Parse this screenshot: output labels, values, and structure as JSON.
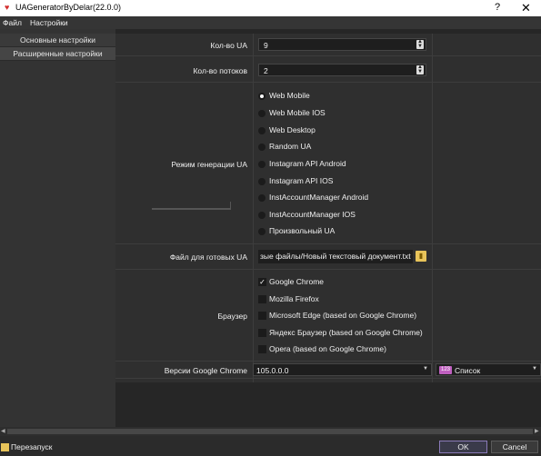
{
  "window": {
    "title": "UAGeneratorByDelar(22.0.0)",
    "help": "?",
    "close": "✕",
    "icon": "app-logo-icon"
  },
  "menu": {
    "items": [
      "Файл",
      "Настройки"
    ]
  },
  "sidebar": {
    "items": [
      {
        "label": "Основные настройки",
        "active": false
      },
      {
        "label": "Расширенные настройки",
        "active": true
      }
    ]
  },
  "settings": {
    "ua_count": {
      "label": "Кол-во UA",
      "value": "9"
    },
    "threads": {
      "label": "Кол-во потоков",
      "value": "2"
    },
    "mode": {
      "label": "Режим генерации UA",
      "selected": "Web Mobile",
      "options": [
        "Web Mobile",
        "Web Mobile IOS",
        "Web Desktop",
        "Random UA",
        "Instagram API Android",
        "Instagram API IOS",
        "InstAccountManager Android",
        "InstAccountManager IOS",
        "Произвольный UA"
      ]
    },
    "output_file": {
      "label": "Файл для готовых UA",
      "value": "зые файлы/Новый текстовый документ.txt"
    },
    "browser": {
      "label": "Браузер",
      "options": [
        {
          "label": "Google Chrome",
          "checked": true
        },
        {
          "label": "Mozilla Firefox",
          "checked": false
        },
        {
          "label": "Microsoft Edge (based on Google Chrome)",
          "checked": false
        },
        {
          "label": "Яндекс Браузер (based on Google Chrome)",
          "checked": false
        },
        {
          "label": "Opera (based on Google Chrome)",
          "checked": false
        }
      ]
    },
    "chrome_versions": {
      "label": "Версии Google Chrome",
      "value": "105.0.0.0",
      "list_label": "Список",
      "list_badge": "123"
    }
  },
  "bottom": {
    "restart_label": "Перезапуск",
    "ok_label": "OK",
    "cancel_label": "Cancel"
  }
}
